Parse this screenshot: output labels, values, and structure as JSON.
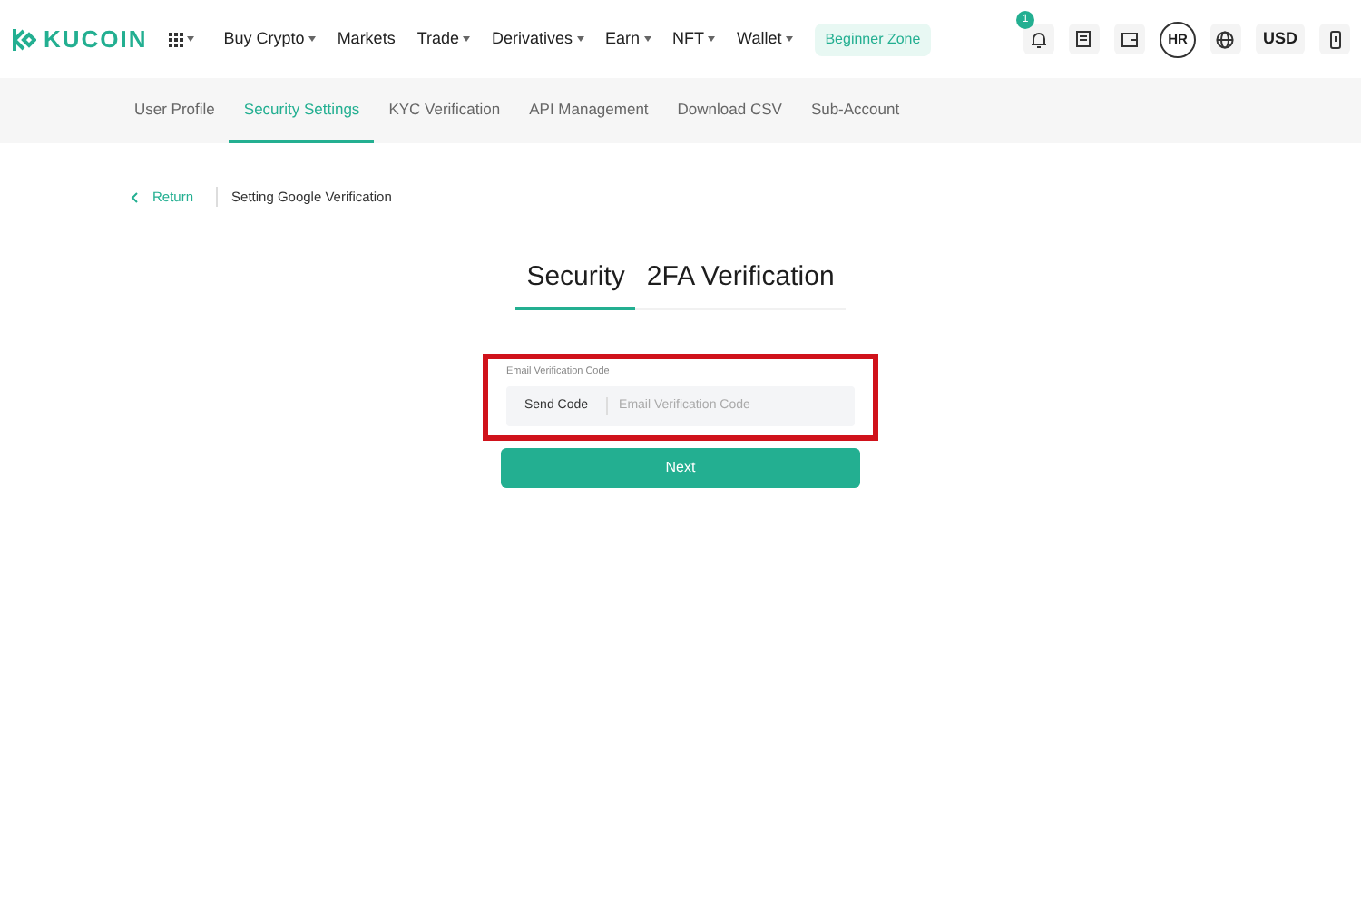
{
  "header": {
    "logo": "KUCOIN",
    "apps_menu": {
      "dropdown": true
    },
    "nav": [
      {
        "label": "Buy Crypto",
        "dropdown": true
      },
      {
        "label": "Markets",
        "dropdown": false
      },
      {
        "label": "Trade",
        "dropdown": true
      },
      {
        "label": "Derivatives",
        "dropdown": true
      },
      {
        "label": "Earn",
        "dropdown": true
      },
      {
        "label": "NFT",
        "dropdown": true
      },
      {
        "label": "Wallet",
        "dropdown": true
      }
    ],
    "beginner_zone": "Beginner Zone",
    "notification_count": "1",
    "avatar": "HR",
    "currency": "USD"
  },
  "account_tabs": [
    {
      "label": "User Profile",
      "selected": false
    },
    {
      "label": "Security Settings",
      "selected": true
    },
    {
      "label": "KYC Verification",
      "selected": false
    },
    {
      "label": "API Management",
      "selected": false
    },
    {
      "label": "Download CSV",
      "selected": false
    },
    {
      "label": "Sub-Account",
      "selected": false
    }
  ],
  "breadcrumb": {
    "return": "Return",
    "title": "Setting Google Verification"
  },
  "tabs": [
    {
      "label": "Security",
      "selected": true
    },
    {
      "label": "2FA Verification",
      "selected": false
    }
  ],
  "form": {
    "label": "Email Verification Code",
    "send_button": "Send Code",
    "placeholder": "Email Verification Code",
    "highlighted": true,
    "submit": "Next"
  }
}
